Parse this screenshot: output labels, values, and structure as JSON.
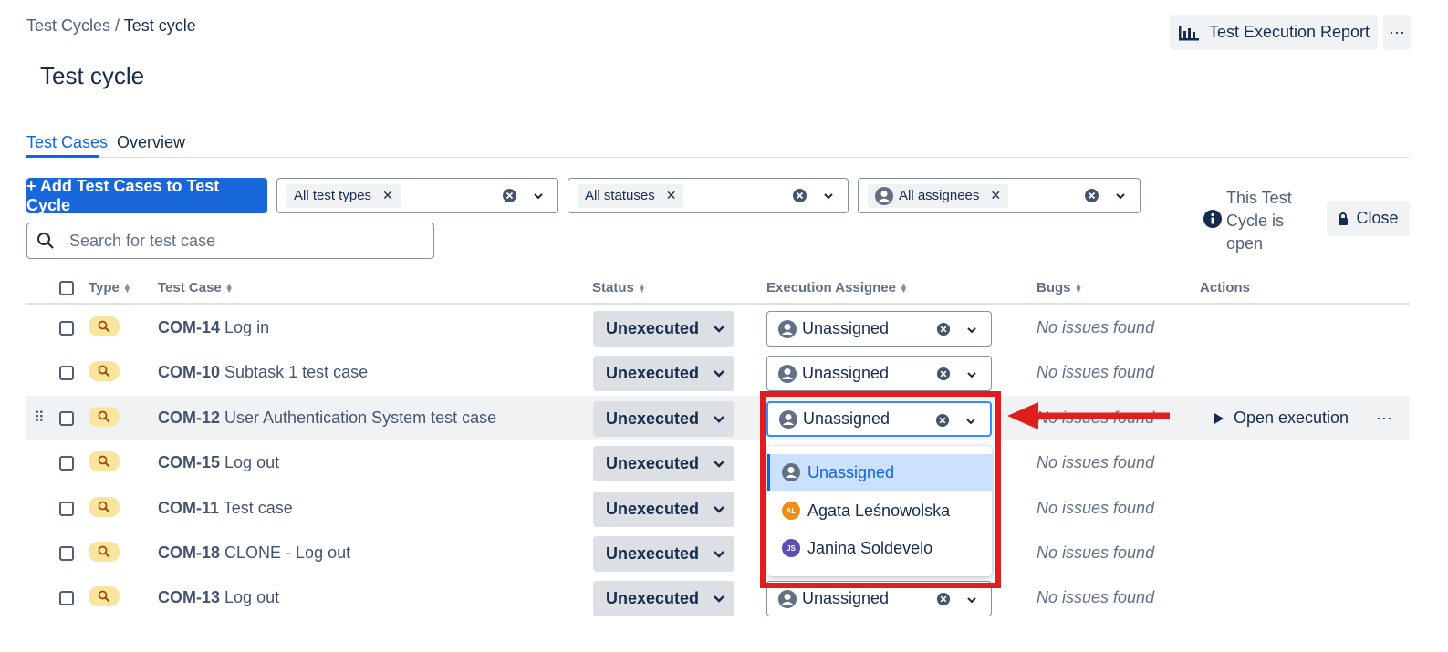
{
  "breadcrumb": {
    "parent": "Test Cycles",
    "separator": "/",
    "current": "Test cycle"
  },
  "page_title": "Test cycle",
  "header": {
    "report_button": "Test Execution Report",
    "more_label": "···"
  },
  "tabs": [
    {
      "label": "Test Cases"
    },
    {
      "label": "Overview"
    }
  ],
  "toolbar": {
    "add_button": "+ Add Test Cases to Test Cycle",
    "filters": [
      {
        "chip": "All test types"
      },
      {
        "chip": "All statuses"
      },
      {
        "chip": "All assignees"
      }
    ],
    "search_placeholder": "Search for test case"
  },
  "cycle_info": {
    "text": "This Test Cycle is open",
    "close_button": "Close"
  },
  "columns": {
    "type": "Type",
    "test_case": "Test Case",
    "status": "Status",
    "assignee": "Execution Assignee",
    "bugs": "Bugs",
    "actions": "Actions"
  },
  "rows": [
    {
      "key": "COM-14",
      "name": "Log in",
      "status": "Unexecuted",
      "assignee": "Unassigned",
      "bugs": "No issues found"
    },
    {
      "key": "COM-10",
      "name": "Subtask 1 test case",
      "status": "Unexecuted",
      "assignee": "Unassigned",
      "bugs": "No issues found"
    },
    {
      "key": "COM-12",
      "name": "User Authentication System test case",
      "status": "Unexecuted",
      "assignee": "Unassigned",
      "bugs": "No issues found",
      "action": "Open execution"
    },
    {
      "key": "COM-15",
      "name": "Log out",
      "status": "Unexecuted",
      "bugs": "No issues found"
    },
    {
      "key": "COM-11",
      "name": "Test case",
      "status": "Unexecuted",
      "bugs": "No issues found"
    },
    {
      "key": "COM-18",
      "name": "CLONE - Log out",
      "status": "Unexecuted",
      "bugs": "No issues found"
    },
    {
      "key": "COM-13",
      "name": "Log out",
      "status": "Unexecuted",
      "assignee": "Unassigned",
      "bugs": "No issues found"
    }
  ],
  "assignee_menu": [
    {
      "label": "Unassigned",
      "selected": true
    },
    {
      "label": "Agata Leśnowolska",
      "initials": "AL",
      "color": "#f18d13"
    },
    {
      "label": "Janina Soldevelo",
      "initials": "JS",
      "color": "#5e4db2"
    }
  ],
  "colors": {
    "primary": "#1868db",
    "annotation": "#e01e1e",
    "type_badge": "#f8e6a0"
  }
}
